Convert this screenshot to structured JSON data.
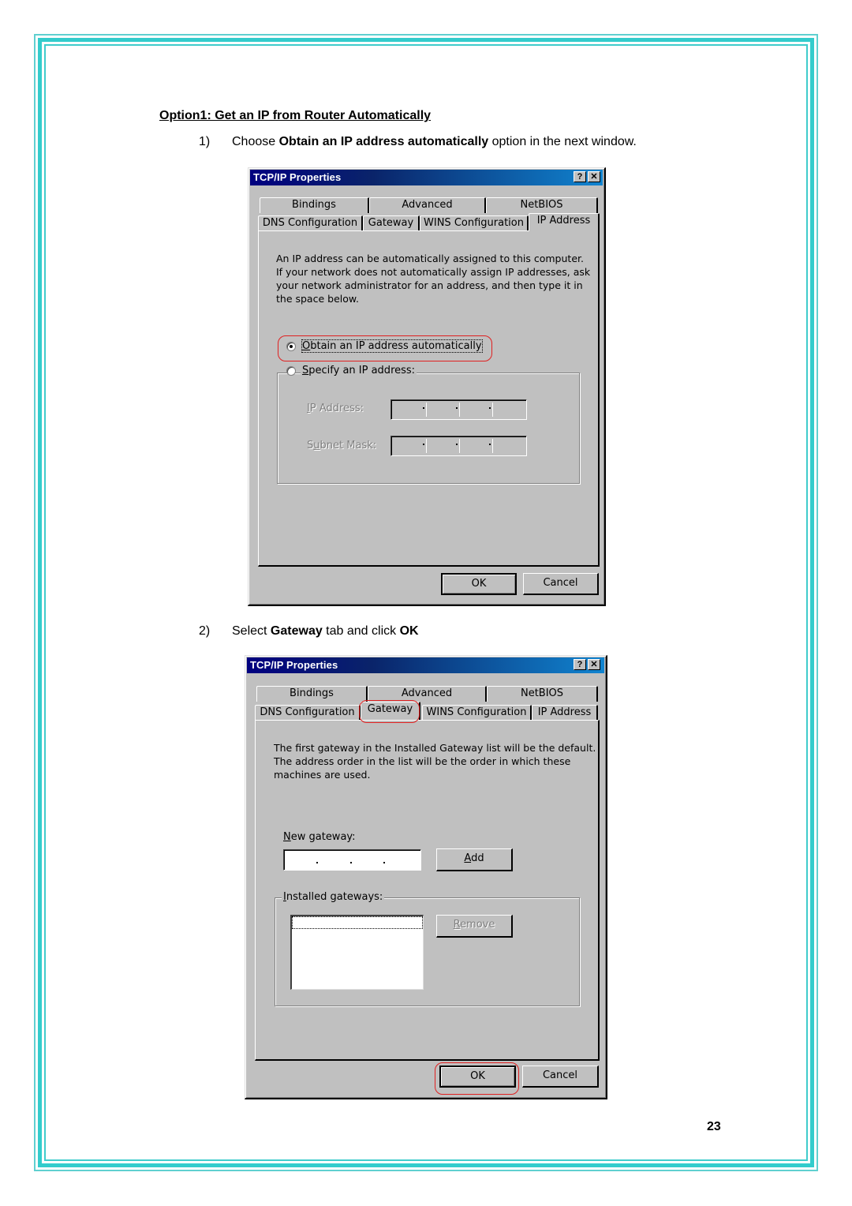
{
  "page": {
    "heading": "Option1: Get an IP from Router Automatically",
    "page_number": "23",
    "frame_color": "#33cccc",
    "highlight_color": "#e02020",
    "steps": [
      {
        "number": "1)",
        "prefix": "Choose ",
        "bold": "Obtain an IP address automatically",
        "suffix": " option in the next window."
      },
      {
        "number": "2)",
        "prefix": "Select ",
        "bold": "Gateway",
        "middle": " tab and click ",
        "bold2": "OK"
      }
    ]
  },
  "dialog1": {
    "title": "TCP/IP Properties",
    "help_button": "?",
    "close_button": "✕",
    "tabs_row1": [
      "Bindings",
      "Advanced",
      "NetBIOS"
    ],
    "tabs_row2": [
      "DNS Configuration",
      "Gateway",
      "WINS Configuration",
      "IP Address"
    ],
    "active_tab": "IP Address",
    "description": [
      "An IP address can be automatically assigned to this computer.",
      "If your network does not automatically assign IP addresses, ask",
      "your network administrator for an address, and then type it in",
      "the space below."
    ],
    "radio_auto": {
      "accel": "O",
      "rest": "btain an IP address automatically",
      "selected": true
    },
    "radio_specify": {
      "accel": "S",
      "rest": "pecify an IP address:",
      "selected": false
    },
    "ip_address_label": {
      "accel": "I",
      "rest": "P Address:"
    },
    "subnet_mask_label": {
      "pre": "S",
      "accel": "u",
      "rest": "bnet Mask:"
    },
    "ip_address_value": "",
    "subnet_mask_value": "",
    "ok_label": "OK",
    "cancel_label": "Cancel"
  },
  "dialog2": {
    "title": "TCP/IP Properties",
    "help_button": "?",
    "close_button": "✕",
    "tabs_row1": [
      "Bindings",
      "Advanced",
      "NetBIOS"
    ],
    "tabs_row2": [
      "DNS Configuration",
      "Gateway",
      "WINS Configuration",
      "IP Address"
    ],
    "active_tab": "Gateway",
    "description": [
      "The first gateway in the Installed Gateway list will be the default.",
      "The address order in the list will be the order in which these",
      "machines are used."
    ],
    "new_gateway_label": {
      "accel": "N",
      "rest": "ew gateway:"
    },
    "new_gateway_value": "",
    "add_label": {
      "accel": "A",
      "rest": "dd"
    },
    "installed_gateways_label": {
      "accel": "I",
      "rest": "nstalled gateways:"
    },
    "installed_gateways": [],
    "remove_label": {
      "accel": "R",
      "rest": "emove"
    },
    "ok_label": "OK",
    "cancel_label": "Cancel"
  }
}
